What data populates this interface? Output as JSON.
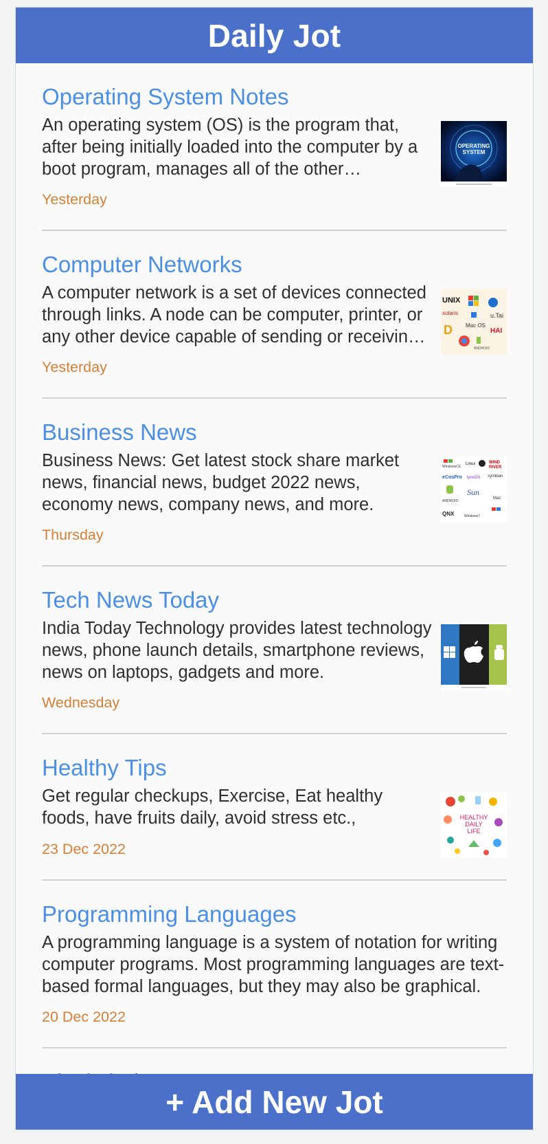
{
  "header": {
    "title": "Daily Jot"
  },
  "jots": [
    {
      "title": "Operating System Notes",
      "body": "An operating system (OS) is the program that, after being initially loaded into the computer by a boot program, manages all of the other application programs in a computer.",
      "date": "Yesterday",
      "thumb_icon": "operating-system-thumbnail",
      "thumb_text": "OPERATING SYSTEM"
    },
    {
      "title": "Computer Networks",
      "body": "A computer network is a set of devices connected through links. A node can be computer, printer, or any other device capable of sending or receiving data.",
      "date": "Yesterday",
      "thumb_icon": "os-logos-collage-thumbnail",
      "thumb_text": "UNIX"
    },
    {
      "title": "Business News",
      "body": "Business News: Get latest stock share market news, financial news, budget 2022 news, economy news, company news, and more.",
      "date": "Thursday",
      "thumb_icon": "os-logos-grid-thumbnail",
      "thumb_text": "ANDROID"
    },
    {
      "title": "Tech News Today",
      "body": "India Today Technology provides latest technology news, phone launch details, smartphone reviews, news on laptops, gadgets and more.",
      "date": "Wednesday",
      "thumb_icon": "windows-apple-android-thumbnail",
      "thumb_text": ""
    },
    {
      "title": "Healthy Tips",
      "body": "Get regular checkups, Exercise, Eat healthy foods, have fruits daily, avoid stress etc.,",
      "date": "23 Dec 2022",
      "thumb_icon": "healthy-daily-life-thumbnail",
      "thumb_text": "HEALTHY DAILY LIFE"
    },
    {
      "title": "Programming Languages",
      "body": "A programming language is a system of notation for writing computer programs. Most programming languages are text-based formal languages, but they may also be graphical.",
      "date": "20 Dec 2022",
      "thumb_icon": "",
      "thumb_text": ""
    },
    {
      "title": "Blockchain",
      "body": "",
      "date": "",
      "thumb_icon": "",
      "thumb_text": ""
    }
  ],
  "footer": {
    "add_label": "+ Add New Jot"
  },
  "colors": {
    "accent": "#4a70c9",
    "title_link": "#4a8fe3",
    "date": "#d47f34",
    "text": "#2f2f2f"
  }
}
